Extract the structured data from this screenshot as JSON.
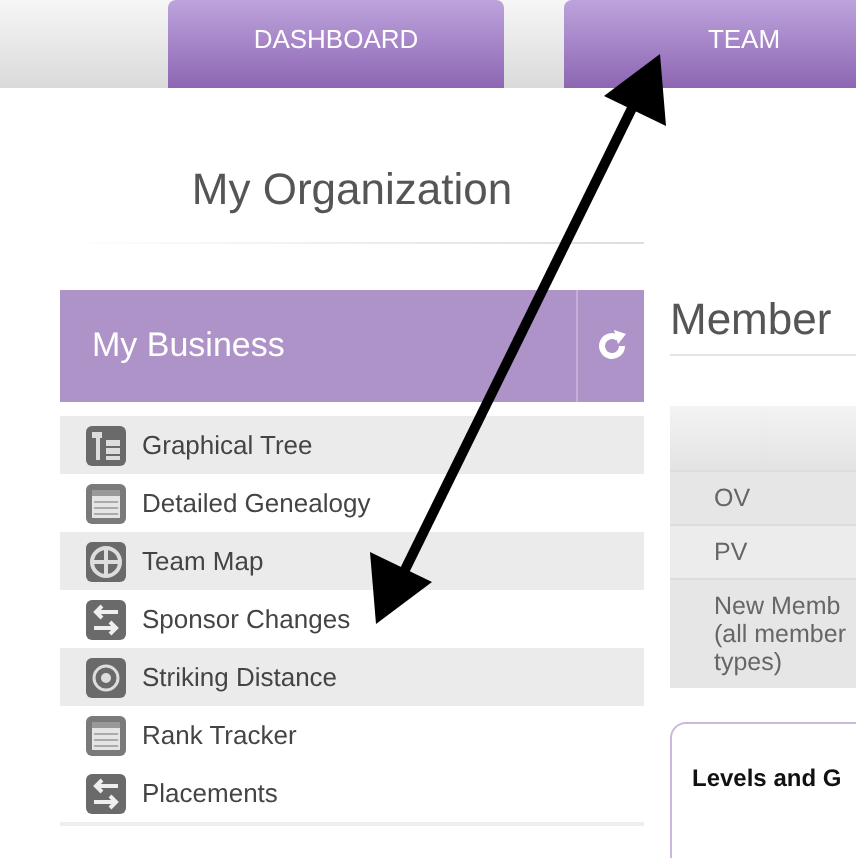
{
  "nav_tabs": [
    {
      "label": "DASHBOARD"
    },
    {
      "label": "TEAM"
    }
  ],
  "page_title": "My Organization",
  "sidebar": {
    "title": "My Business",
    "items": [
      {
        "label": "Graphical Tree",
        "kind": "tree",
        "shaded": true
      },
      {
        "label": "Detailed Genealogy",
        "kind": "list",
        "shaded": false
      },
      {
        "label": "Team Map",
        "kind": "map",
        "shaded": true
      },
      {
        "label": "Sponsor Changes",
        "kind": "swap",
        "shaded": false
      },
      {
        "label": "Striking Distance",
        "kind": "target",
        "shaded": true
      },
      {
        "label": "Rank Tracker",
        "kind": "list",
        "shaded": false
      },
      {
        "label": "Placements",
        "kind": "swap",
        "shaded": false
      }
    ]
  },
  "member_panel": {
    "title": "Member",
    "rows": [
      "OV",
      "PV",
      "New Memb\n(all member\ntypes)"
    ],
    "card_title": "Levels and G"
  }
}
